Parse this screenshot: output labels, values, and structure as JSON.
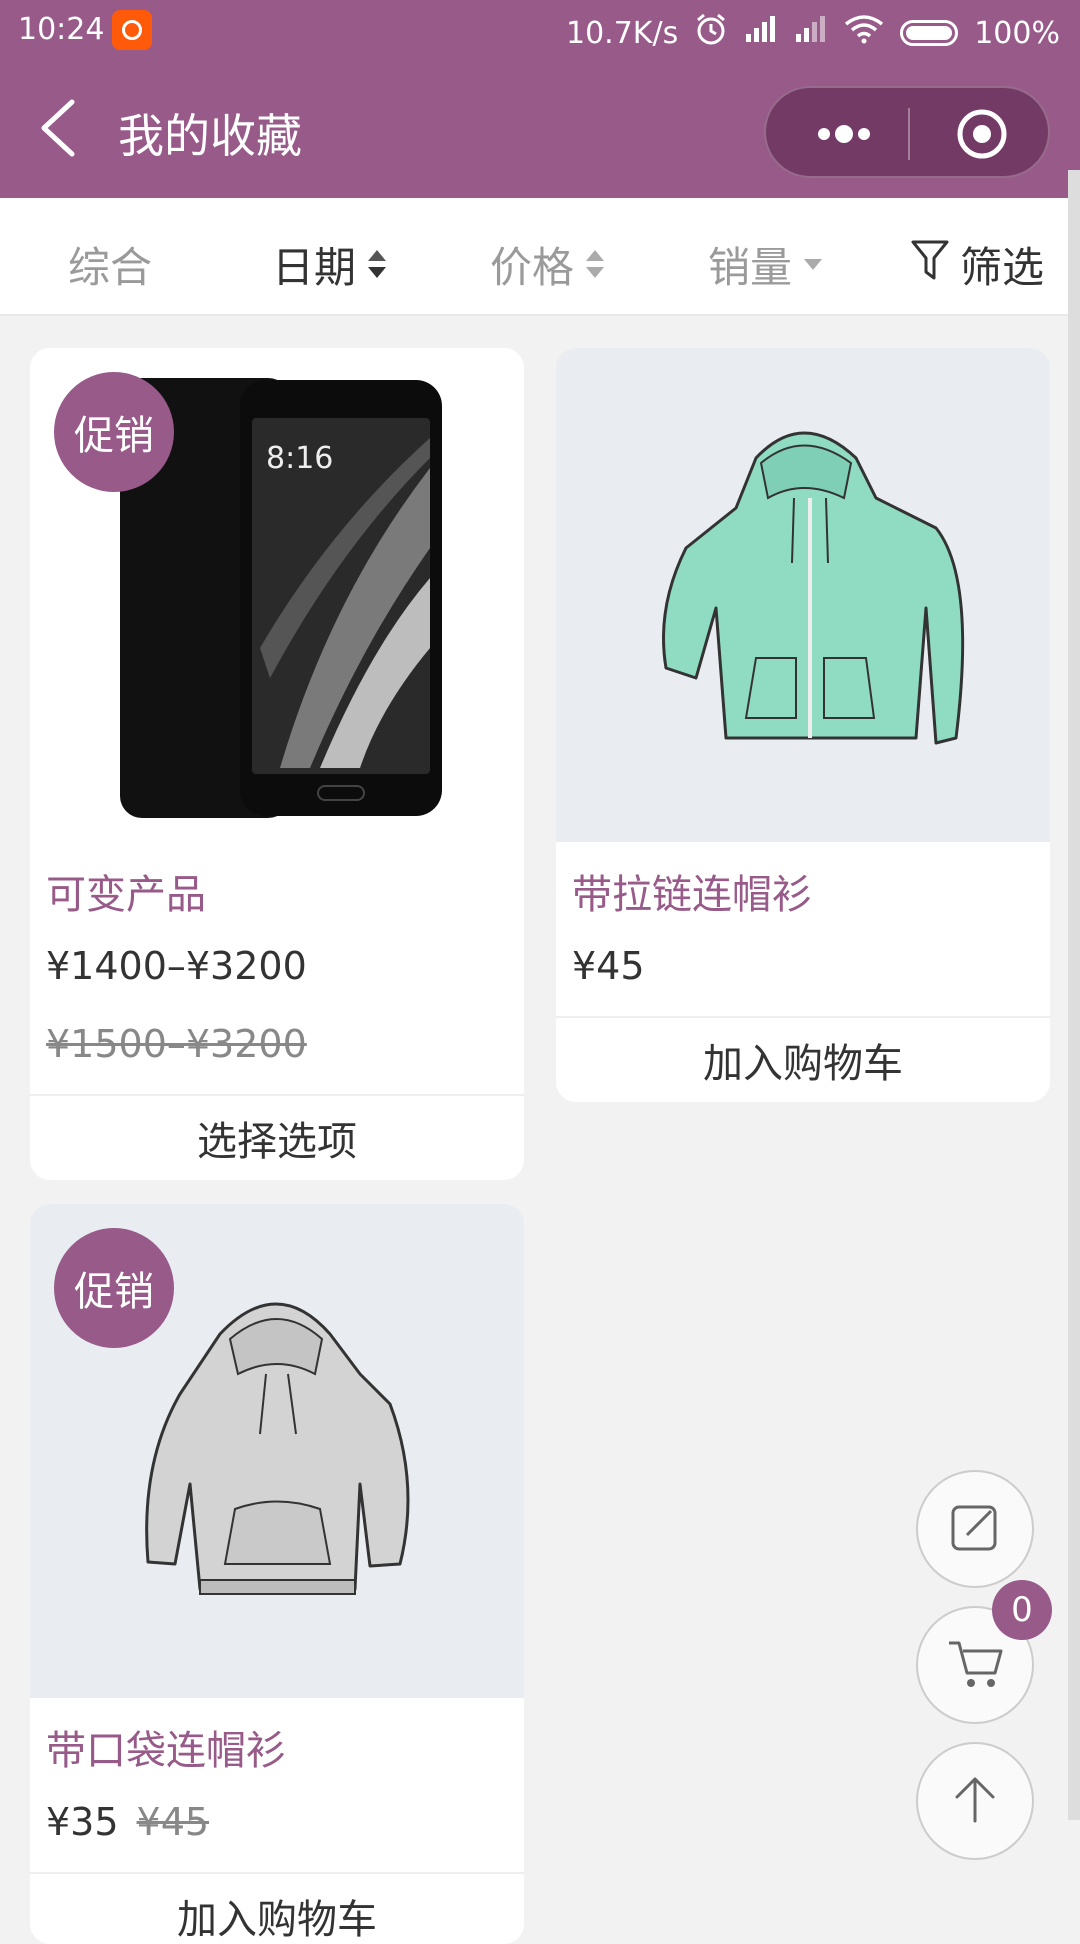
{
  "status_bar": {
    "time": "10:24",
    "net_speed": "10.7K/s",
    "battery": "100%"
  },
  "nav": {
    "title": "我的收藏"
  },
  "filters": [
    {
      "label": "综合",
      "active": false
    },
    {
      "label": "日期",
      "active": true
    },
    {
      "label": "价格",
      "active": false
    },
    {
      "label": "销量",
      "active": false
    },
    {
      "label": "筛选",
      "active": false
    }
  ],
  "products": [
    {
      "badge": "促销",
      "name": "可变产品",
      "price": "¥1400–¥3200",
      "old_price": "¥1500–¥3200",
      "action": "选择选项",
      "image": "black-smartphone"
    },
    {
      "name": "带拉链连帽衫",
      "price": "¥45",
      "action": "加入购物车",
      "image": "mint-zip-hoodie"
    },
    {
      "badge": "促销",
      "name": "带口袋连帽衫",
      "price": "¥35",
      "old_price": "¥45",
      "action": "加入购物车",
      "image": "gray-pocket-hoodie"
    }
  ],
  "cart": {
    "count": "0"
  },
  "colors": {
    "brand": "#975a89",
    "background": "#f2f2f2"
  }
}
